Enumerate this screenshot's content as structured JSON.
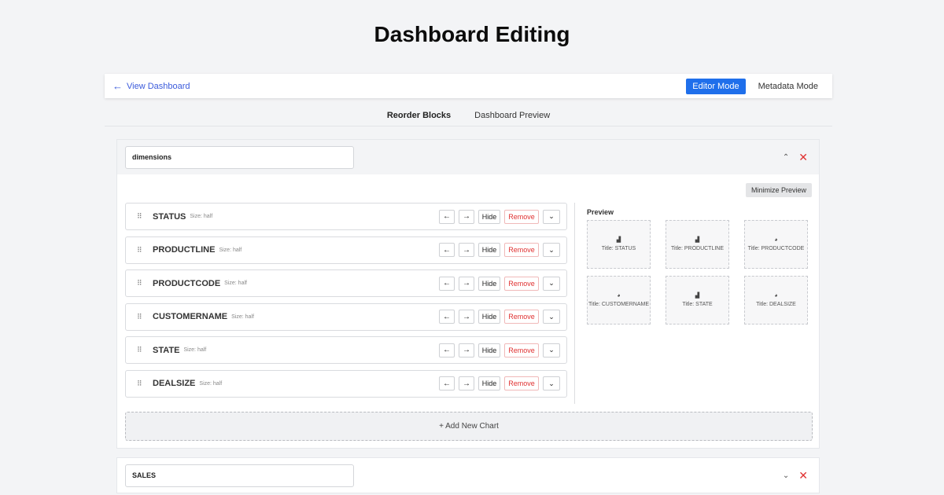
{
  "page": {
    "title": "Dashboard Editing"
  },
  "topbar": {
    "back_label": "View Dashboard",
    "editor_mode": "Editor Mode",
    "metadata_mode": "Metadata Mode"
  },
  "tabs": [
    {
      "label": "Reorder Blocks",
      "active": true
    },
    {
      "label": "Dashboard Preview",
      "active": false
    }
  ],
  "blocks": [
    {
      "name": "dimensions",
      "minimize_label": "Minimize Preview",
      "preview_label": "Preview",
      "add_label": "+ Add New Chart",
      "charts": [
        {
          "name": "STATUS",
          "size": "Size: half"
        },
        {
          "name": "PRODUCTLINE",
          "size": "Size: half"
        },
        {
          "name": "PRODUCTCODE",
          "size": "Size: half"
        },
        {
          "name": "CUSTOMERNAME",
          "size": "Size: half"
        },
        {
          "name": "STATE",
          "size": "Size: half"
        },
        {
          "name": "DEALSIZE",
          "size": "Size: half"
        }
      ],
      "row_controls": {
        "left": "←",
        "right": "→",
        "hide": "Hide",
        "remove": "Remove"
      },
      "preview_cards": [
        {
          "title": "Title: STATUS",
          "icon": "bar-chart-icon"
        },
        {
          "title": "Title: PRODUCTLINE",
          "icon": "bar-chart-icon"
        },
        {
          "title": "Title: PRODUCTCODE",
          "icon": "pie-chart-icon"
        },
        {
          "title": "Title: CUSTOMERNAME",
          "icon": "pie-chart-icon"
        },
        {
          "title": "Title: STATE",
          "icon": "bar-chart-icon"
        },
        {
          "title": "Title: DEALSIZE",
          "icon": "pie-chart-icon"
        }
      ]
    },
    {
      "name": "SALES"
    }
  ],
  "colors": {
    "accent": "#1f6feb",
    "danger": "#e03131",
    "link": "#3b5bdb"
  }
}
